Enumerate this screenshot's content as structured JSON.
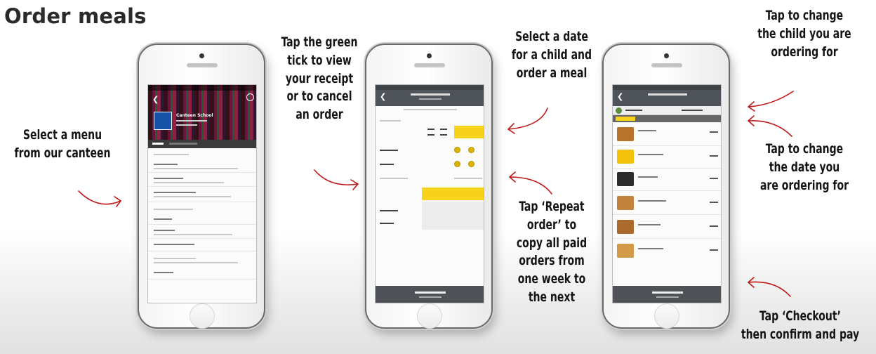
{
  "title": "Order meals",
  "captions": {
    "select_menu": [
      "Select a menu",
      "from our canteen"
    ],
    "green_tick": [
      "Tap the green",
      "tick to view",
      "your receipt",
      "or to cancel",
      "an order"
    ],
    "select_date": [
      "Select a date",
      "for a child and",
      "order a meal"
    ],
    "repeat_order": [
      "Tap ‘Repeat",
      "order’ to",
      "copy all paid",
      "orders from",
      "one week to",
      "the next"
    ],
    "change_child": [
      "Tap to change",
      "the child you are",
      "ordering for"
    ],
    "change_date": [
      "Tap to change",
      "the date you",
      "are ordering for"
    ],
    "checkout": [
      "Tap ‘Checkout’",
      "then confirm and pay"
    ]
  },
  "phone1": {
    "canteen_name": "Canteen School"
  },
  "colors": {
    "arrow": "#c01818",
    "accent_yellow": "#f6d21a",
    "navbar": "#4e5459"
  },
  "icons": [
    "back-chevron-icon",
    "info-icon",
    "green-tick-icon",
    "child-avatar-icon"
  ]
}
